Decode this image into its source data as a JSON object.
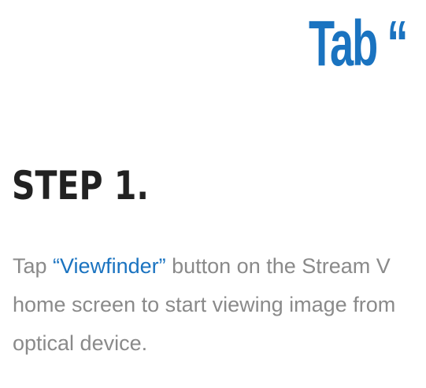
{
  "header": {
    "headline": "Tab “"
  },
  "step": {
    "title": "STEP 1.",
    "body": {
      "prefix": "Tap ",
      "highlight": "“Viewfinder”",
      "suffix": " button on the Stream V",
      "line2": "home screen to start viewing image from",
      "line3": "optical device."
    }
  },
  "colors": {
    "accent": "#1a73c0",
    "heading": "#222222",
    "body_text": "#8a8a8a",
    "background": "#ffffff"
  }
}
